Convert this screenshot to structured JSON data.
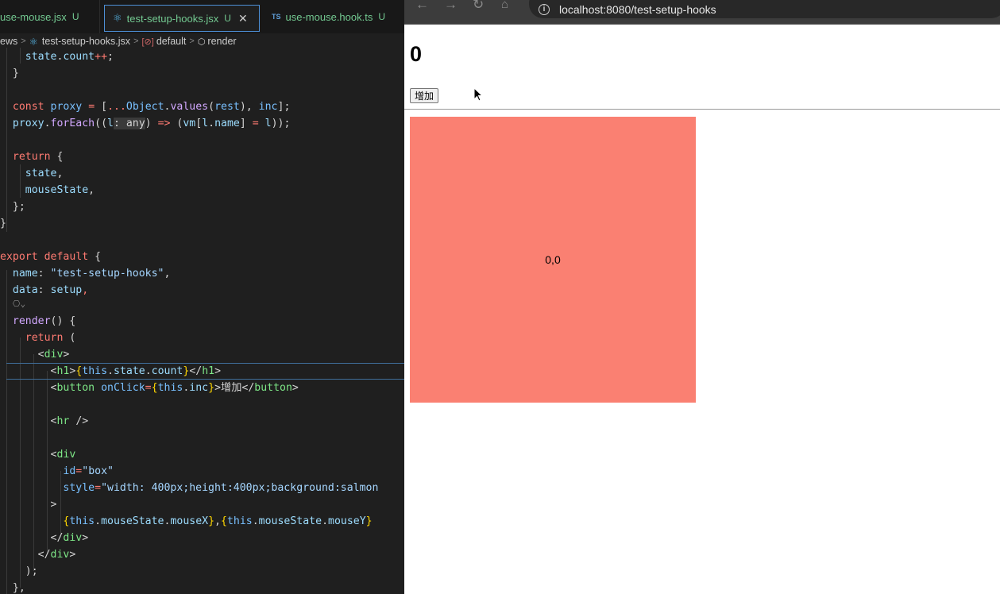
{
  "editor": {
    "tabs": [
      {
        "label": "use-mouse.jsx",
        "status": "U"
      },
      {
        "label": "test-setup-hooks.jsx",
        "status": "U",
        "active": true
      },
      {
        "label": "use-mouse.hook.ts",
        "status": "U",
        "badge": "TS"
      }
    ],
    "breadcrumb": {
      "folder": "ews",
      "file": "test-setup-hooks.jsx",
      "symbol": "default",
      "method": "render"
    },
    "code_lines": [
      "    state.count++;",
      "  }",
      "",
      "  const proxy = [...Object.values(rest), inc];",
      "  proxy.forEach((l: any) => (vm[l.name] = l));",
      "",
      "  return {",
      "    state,",
      "    mouseState,",
      "  };",
      "}",
      "",
      "export default {",
      "  name: \"test-setup-hooks\",",
      "  data: setup,",
      "  render() {",
      "    return (",
      "      <div>",
      "        <h1>{this.state.count}</h1>",
      "        <button onClick={this.inc}>增加</button>",
      "",
      "        <hr />",
      "",
      "        <div",
      "          id=\"box\"",
      "          style=\"width: 400px;height:400px;background:salmon",
      "        >",
      "          {this.mouseState.mouseX},{this.mouseState.mouseY}",
      "        </div>",
      "      </div>",
      "    );",
      "  },"
    ]
  },
  "browser": {
    "url": "localhost:8080/test-setup-hooks",
    "page": {
      "count": "0",
      "button_label": "增加",
      "box_text": "0,0",
      "box_color": "#fa8072"
    }
  }
}
